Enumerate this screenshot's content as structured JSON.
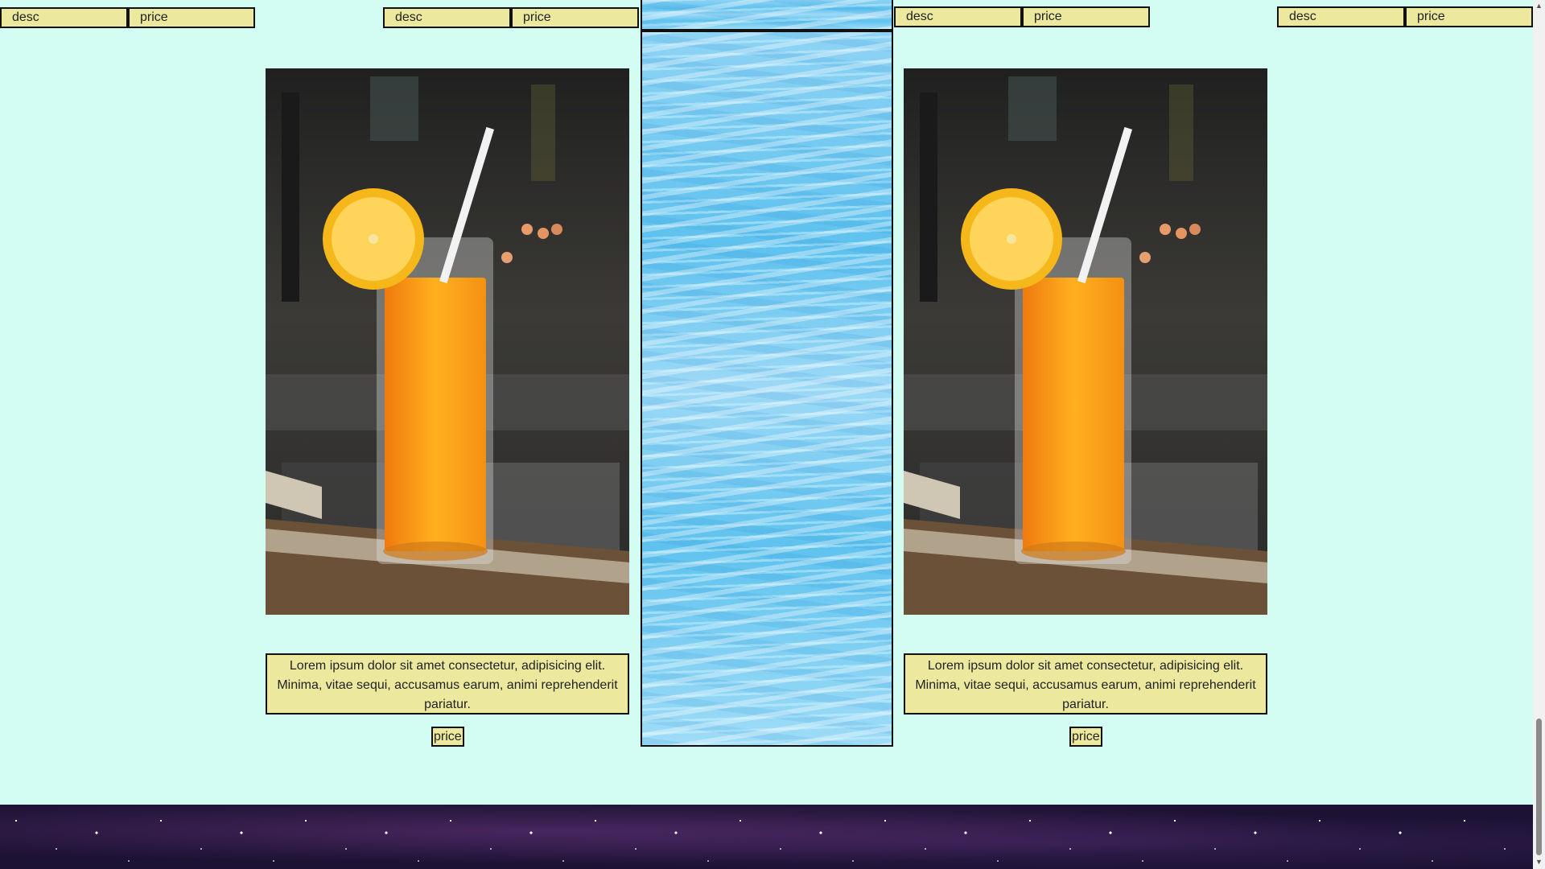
{
  "top_tabs": [
    {
      "desc": "desc",
      "price": "price"
    },
    {
      "desc": "desc",
      "price": "price"
    },
    {
      "desc": "desc",
      "price": "price"
    },
    {
      "desc": "desc",
      "price": "price"
    }
  ],
  "cards": [
    {
      "image": "orange-juice-glass-photo",
      "description": "Lorem ipsum dolor sit amet consectetur, adipisicing elit. Minima, vitae sequi, accusamus earum, animi reprehenderit pariatur.",
      "price_label": "price"
    },
    {
      "image": "orange-juice-glass-photo",
      "description": "Lorem ipsum dolor sit amet consectetur, adipisicing elit. Minima, vitae sequi, accusamus earum, animi reprehenderit pariatur.",
      "price_label": "price"
    }
  ],
  "colors": {
    "page_background": "#d3fcf2",
    "label_background": "#ece99e",
    "border": "#111111",
    "footer_background": "#1c1233"
  },
  "scrollbar": {
    "position_fraction": 0.93
  }
}
